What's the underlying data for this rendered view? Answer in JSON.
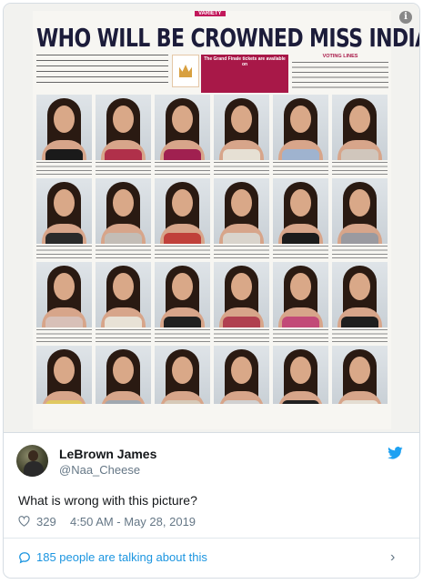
{
  "newspaper": {
    "section": "VARIETY",
    "headline": "WHO WILL BE CROWNED MISS INDIA THIS YEAR?",
    "promo_title": "The Grand Finale tickets are available on",
    "voting_title": "VOTING LINES"
  },
  "contestants": [
    {
      "dress": "#1a1a1a"
    },
    {
      "dress": "#b0304a"
    },
    {
      "dress": "#a02050"
    },
    {
      "dress": "#e6e0d4"
    },
    {
      "dress": "#9fb3cf"
    },
    {
      "dress": "#d0c6bc"
    },
    {
      "dress": "#2a2a2a"
    },
    {
      "dress": "#c3bdb6"
    },
    {
      "dress": "#c0403a"
    },
    {
      "dress": "#d9d4cc"
    },
    {
      "dress": "#1c1c1c"
    },
    {
      "dress": "#9a9aa0"
    },
    {
      "dress": "#d8c0b8"
    },
    {
      "dress": "#e8e2d6"
    },
    {
      "dress": "#202020"
    },
    {
      "dress": "#b04050"
    },
    {
      "dress": "#c24a78"
    },
    {
      "dress": "#1e1e1e"
    },
    {
      "dress": "#e0c860"
    },
    {
      "dress": "#a0a8b0"
    },
    {
      "dress": "#d6c9b8"
    },
    {
      "dress": "#d0d0d0"
    },
    {
      "dress": "#202020"
    },
    {
      "dress": "#e4ddd2"
    }
  ],
  "tweet": {
    "author_name": "LeBrown James",
    "author_handle": "@Naa_Cheese",
    "text": "What is wrong with this picture?",
    "likes": "329",
    "timestamp": "4:50 AM - May 28, 2019",
    "talking": "185 people are talking about this"
  },
  "icons": {
    "info": "info-icon",
    "brand": "twitter-bird-icon",
    "like": "heart-icon",
    "talk": "speech-bubble-icon",
    "chevron": "chevron-right-icon"
  },
  "colors": {
    "brand_blue": "#1da1f2",
    "link_blue": "#1b95e0",
    "muted": "#657786",
    "headline_magenta": "#a81848"
  }
}
